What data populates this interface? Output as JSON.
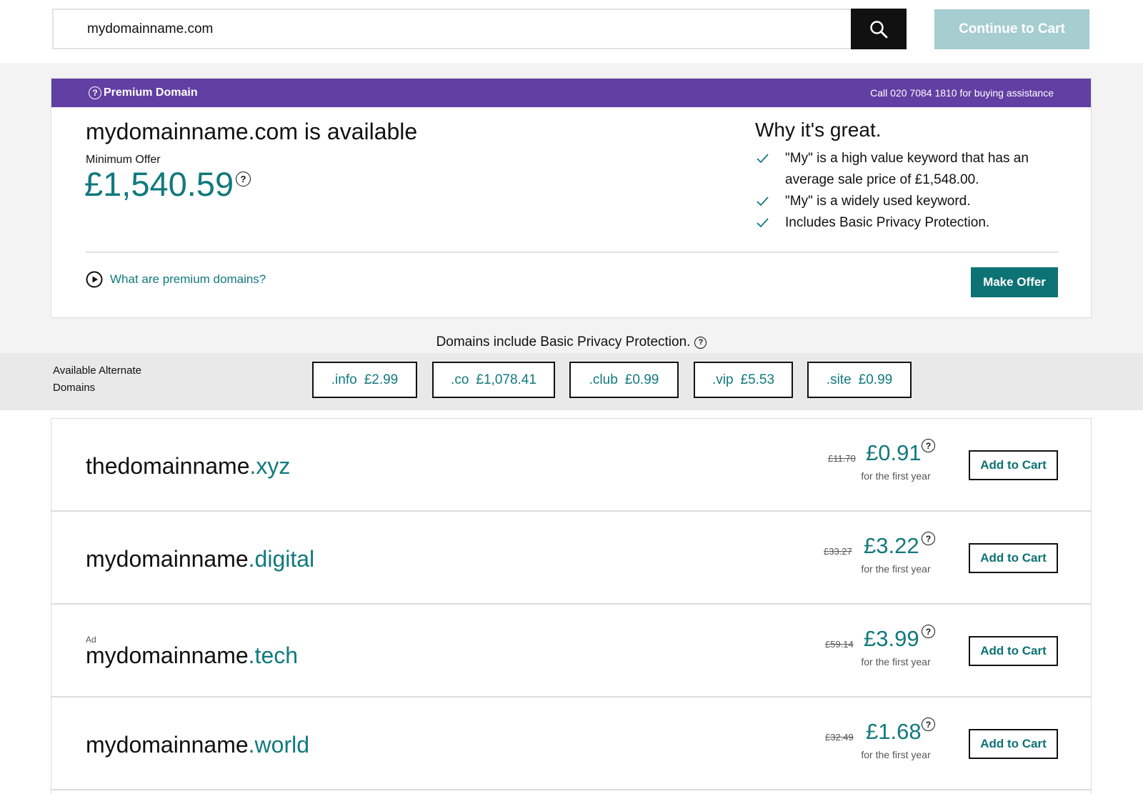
{
  "search": {
    "value": "mydomainname.com",
    "continue_label": "Continue to Cart"
  },
  "premium": {
    "badge_label": "Premium Domain",
    "help_text": "Call 020 7084 1810 for buying assistance",
    "title": "mydomainname.com is available",
    "min_offer_label": "Minimum Offer",
    "price": "£1,540.59",
    "why_title": "Why it's great.",
    "reasons": [
      "\"My\" is a high value keyword that has an average sale price of £1,548.00.",
      "\"My\" is a widely used keyword.",
      "Includes Basic Privacy Protection."
    ],
    "what_link": "What are premium domains?",
    "make_offer_label": "Make Offer"
  },
  "privacy_note": "Domains include Basic Privacy Protection.",
  "alternates": {
    "label": "Available Alternate Domains",
    "chips": [
      {
        "tld": ".info",
        "price": "£2.99"
      },
      {
        "tld": ".co",
        "price": "£1,078.41"
      },
      {
        "tld": ".club",
        "price": "£0.99"
      },
      {
        "tld": ".vip",
        "price": "£5.53"
      },
      {
        "tld": ".site",
        "price": "£0.99"
      }
    ]
  },
  "results": [
    {
      "name": "thedomainname",
      "tld": ".xyz",
      "old_price": "£11.70",
      "price": "£0.91",
      "term": "for the first year",
      "ad": "",
      "cta": "Add to Cart"
    },
    {
      "name": "mydomainname",
      "tld": ".digital",
      "old_price": "£33.27",
      "price": "£3.22",
      "term": "for the first year",
      "ad": "",
      "cta": "Add to Cart"
    },
    {
      "name": "mydomainname",
      "tld": ".tech",
      "old_price": "£59.14",
      "price": "£3.99",
      "term": "for the first year",
      "ad": "Ad",
      "cta": "Add to Cart"
    },
    {
      "name": "mydomainname",
      "tld": ".world",
      "old_price": "£32.49",
      "price": "£1.68",
      "term": "for the first year",
      "ad": "",
      "cta": "Add to Cart"
    }
  ],
  "colors": {
    "accent": "#11797d",
    "premium_header": "#623fa3",
    "continue_button": "#a6cdd0"
  }
}
